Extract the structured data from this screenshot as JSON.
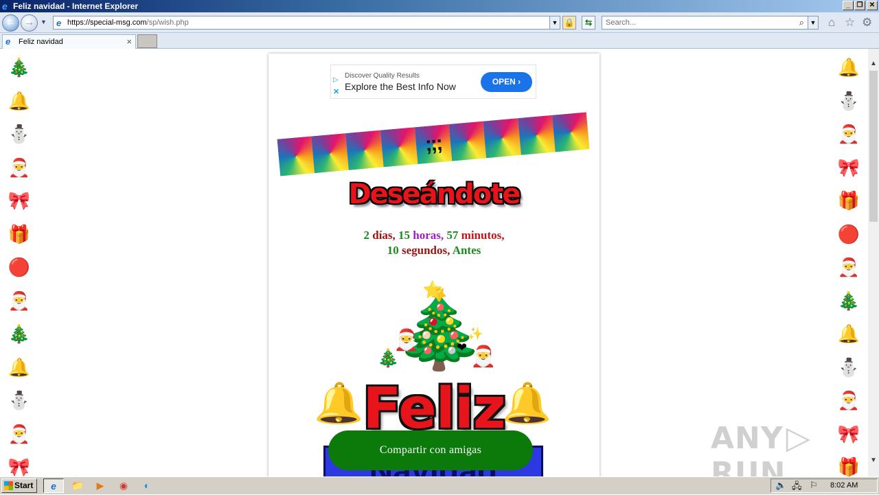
{
  "window": {
    "title": "Feliz navidad - Internet Explorer",
    "min": "_",
    "restore": "❐",
    "close": "✕"
  },
  "nav": {
    "back_icon": "back-arrow-icon",
    "url_https": "https://special-msg.com",
    "url_path": "/sp/wish.php",
    "search_placeholder": "Search...",
    "lock": "🔒",
    "refresh": "⇆"
  },
  "tab": {
    "title": "Feliz navidad",
    "close": "×"
  },
  "ad": {
    "small": "Discover Quality Results",
    "headline": "Explore the Best Info Now",
    "cta": "OPEN ›"
  },
  "page": {
    "heading": "Deseándote",
    "countdown": {
      "d_num": "2",
      "d_lbl": "días,",
      "h_num": "15",
      "h_lbl": "horas,",
      "m_num": "57",
      "m_lbl": "minutos,",
      "s_num": "10",
      "s_lbl": "segundos,",
      "tail": "Antes"
    },
    "feliz": "Feliz",
    "navidad": "Navidad",
    "share_button": "Compartir con amigas",
    "strip_center": ";;;"
  },
  "emojis": {
    "left": [
      "🎄",
      "🔔",
      "⛄",
      "🎅",
      "🎀",
      "🎁",
      "🔴",
      "🎅",
      "🎄",
      "🔔",
      "⛄",
      "🎅",
      "🎀"
    ],
    "right": [
      "🔔",
      "⛄",
      "🎅",
      "🎀",
      "🎁",
      "🔴",
      "🎅",
      "🎄",
      "🔔",
      "⛄",
      "🎅",
      "🎀",
      "🎁"
    ]
  },
  "watermark": {
    "left": "ANY",
    "right": "RUN"
  },
  "taskbar": {
    "start": "Start",
    "clock": "8:02 AM"
  }
}
